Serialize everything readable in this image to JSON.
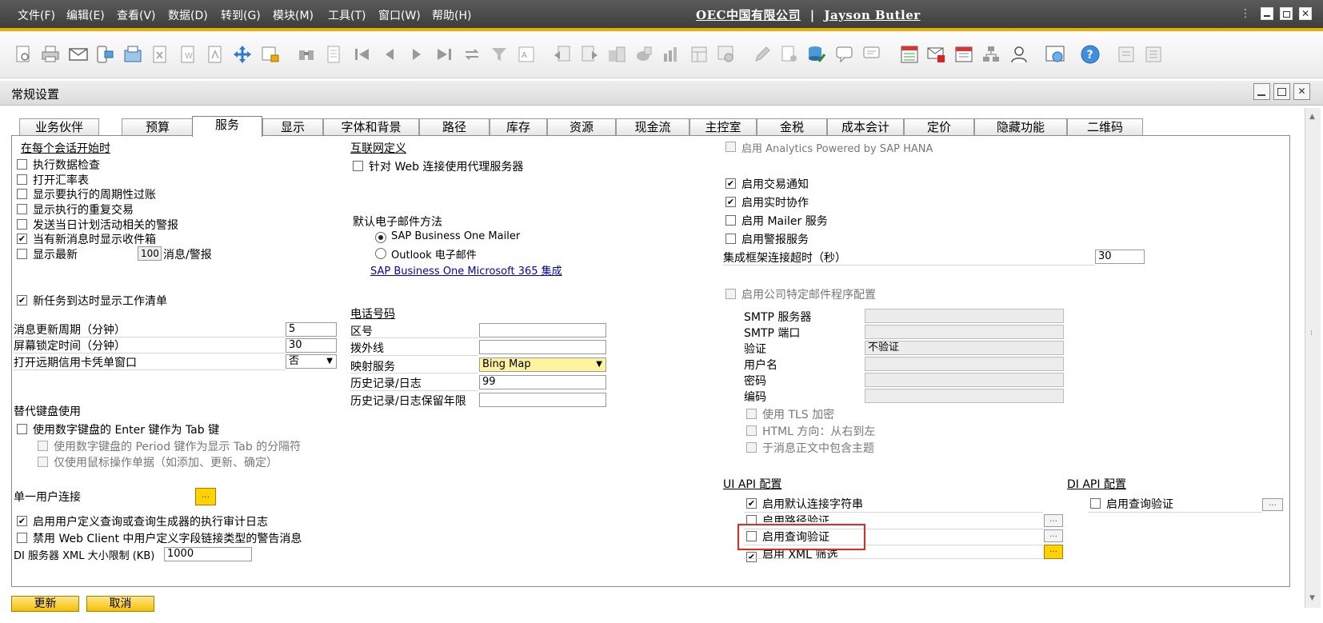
{
  "menu": [
    "文件(F)",
    "编辑(E)",
    "查看(V)",
    "数据(D)",
    "转到(G)",
    "模块(M)",
    "工具(T)",
    "窗口(W)",
    "帮助(H)"
  ],
  "company": "OEC中国有限公司",
  "separator": "|",
  "user": "Jayson Butler",
  "window_title": "常规设置",
  "tabs": [
    "业务伙伴",
    "预算",
    "服务",
    "显示",
    "字体和背景",
    "路径",
    "库存",
    "资源",
    "现金流",
    "主控室",
    "金税",
    "成本会计",
    "定价",
    "隐藏功能",
    "二维码"
  ],
  "left": {
    "session_title": "在每个会话开始时",
    "session_items": [
      {
        "label": "执行数据检查",
        "checked": false
      },
      {
        "label": "打开汇率表",
        "checked": false
      },
      {
        "label": "显示要执行的周期性过账",
        "checked": false
      },
      {
        "label": "显示执行的重复交易",
        "checked": false
      },
      {
        "label": "发送当日计划活动相关的警报",
        "checked": false
      },
      {
        "label": "当有新消息时显示收件箱",
        "checked": true
      }
    ],
    "show_latest_pre": "显示最新",
    "show_latest_count": "100",
    "show_latest_post": "消息/警报",
    "worklist": "新任务到达时显示工作清单",
    "msg_refresh_label": "消息更新周期（分钟）",
    "msg_refresh_value": "5",
    "lock_label": "屏幕锁定时间（分钟）",
    "lock_value": "30",
    "credit_label": "打开远期信用卡凭单窗口",
    "credit_value": "否",
    "keypad_title": "替代键盘使用",
    "keypad_enter": "使用数字键盘的 Enter 键作为 Tab 键",
    "keypad_period": "使用数字键盘的 Period 键作为显示 Tab 的分隔符",
    "keypad_mouse": "仅使用鼠标操作单据（如添加、更新、确定）",
    "single_user": "单一用户连接",
    "audit_log": "启用用户定义查询或查询生成器的执行审计日志",
    "web_client": "禁用 Web Client 中用户定义字段链接类型的警告消息",
    "di_xml_label": "DI 服务器 XML 大小限制 (KB)",
    "di_xml_value": "1000"
  },
  "middle": {
    "internet_title": "互联网定义",
    "proxy": "针对 Web 连接使用代理服务器",
    "email_title": "默认电子邮件方法",
    "email_options": [
      "SAP Business One Mailer",
      "Outlook 电子邮件"
    ],
    "email_selected": 0,
    "ms365_link": "SAP Business One Microsoft 365 集成",
    "phone_title": "电话号码",
    "area_code": "区号",
    "extension": "拨外线",
    "map_label": "映射服务",
    "map_value": "Bing Map",
    "history_label": "历史记录/日志",
    "history_value": "99",
    "history_years": "历史记录/日志保留年限"
  },
  "right": {
    "analytics": "启用 Analytics Powered by SAP HANA",
    "trans_notify": "启用交易通知",
    "realtime": "启用实时协作",
    "mailer_service": "启用 Mailer 服务",
    "alert_service": "启用警报服务",
    "timeout_label": "集成框架连接超时（秒）",
    "timeout_value": "30",
    "company_mail": "启用公司特定邮件程序配置",
    "smtp_server": "SMTP 服务器",
    "smtp_port": "SMTP 端口",
    "auth": "验证",
    "auth_value": "不验证",
    "username": "用户名",
    "password": "密码",
    "encoding": "编码",
    "tls": "使用 TLS 加密",
    "html_dir": "HTML 方向：从右到左",
    "subject": "于消息正文中包含主题",
    "ui_api_title": "UI API 配置",
    "ui_default_conn": "启用默认连接字符串",
    "ui_path": "启用路径验证",
    "ui_query": "启用查询验证",
    "ui_xml": "启用 XML 筛选",
    "di_api_title": "DI API 配置",
    "di_query": "启用查询验证"
  },
  "buttons": {
    "update": "更新",
    "cancel": "取消"
  },
  "colors": {
    "accent": "#f0ab00",
    "highlight": "#e8281e",
    "link": "#0000cc",
    "yellow_field": "#fff3a0"
  }
}
